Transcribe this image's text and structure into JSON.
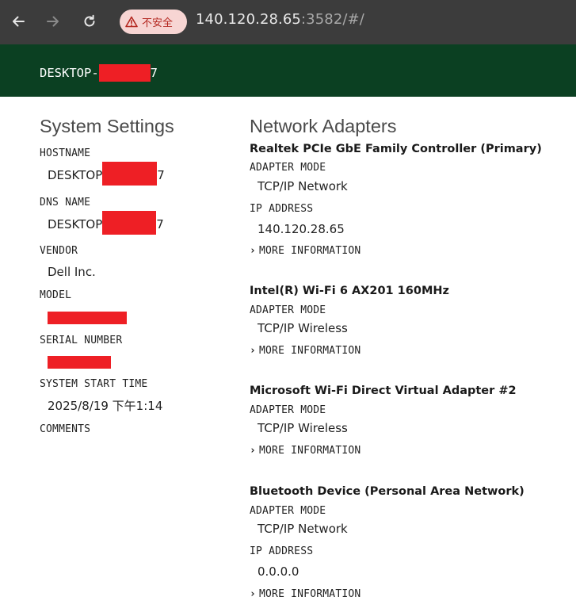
{
  "browser": {
    "security_label": "不安全",
    "url_host": "140.120.28.65",
    "url_rest": ":3582/#/"
  },
  "header": {
    "title_prefix": "DESKTOP-",
    "title_suffix": "7"
  },
  "system_settings": {
    "title": "System Settings",
    "hostname_label": "HOSTNAME",
    "hostname_prefix": "DESKTOP",
    "hostname_suffix": "7",
    "dns_label": "DNS NAME",
    "dns_prefix": "DESKTOP",
    "dns_suffix": "7",
    "vendor_label": "VENDOR",
    "vendor_value": "Dell Inc.",
    "model_label": "MODEL",
    "serial_label": "SERIAL NUMBER",
    "start_time_label": "SYSTEM START TIME",
    "start_time_value": "2025/8/19 下午1:14",
    "comments_label": "COMMENTS"
  },
  "network": {
    "title": "Network Adapters",
    "mode_label": "ADAPTER MODE",
    "ip_label": "IP ADDRESS",
    "more_label": "MORE INFORMATION",
    "adapters": [
      {
        "name": "Realtek PCIe GbE Family Controller (Primary)",
        "mode": "TCP/IP Network",
        "ip": "140.120.28.65"
      },
      {
        "name": "Intel(R) Wi-Fi 6 AX201 160MHz",
        "mode": "TCP/IP Wireless"
      },
      {
        "name": "Microsoft Wi-Fi Direct Virtual Adapter #2",
        "mode": "TCP/IP Wireless"
      },
      {
        "name": "Bluetooth Device (Personal Area Network)",
        "mode": "TCP/IP Network",
        "ip": "0.0.0.0"
      }
    ]
  },
  "colors": {
    "chrome_bg": "#3c3c3c",
    "header_bg": "#0b4022",
    "redaction": "#ee1f25"
  }
}
